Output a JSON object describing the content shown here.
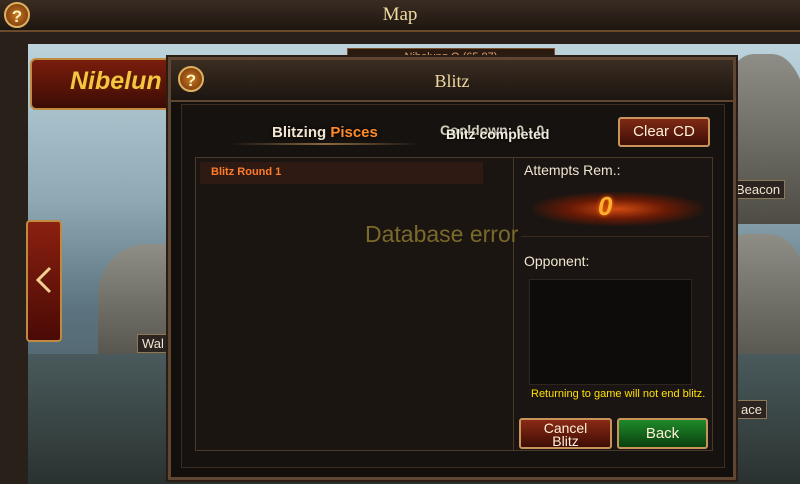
{
  "map": {
    "title": "Map",
    "help_label": "?",
    "region_name": "Nibelun",
    "location_header": "Nibelung O (65,87)",
    "labels": {
      "left_label": "Wal",
      "right_label_top": "Beacon",
      "right_label_bottom": "ace"
    },
    "nav_left_icon": "arrow-left-icon"
  },
  "blitz": {
    "title": "Blitz",
    "help_label": "?",
    "status_prefix": "Blitzing",
    "status_target": "Pisces",
    "cooldown_text": "Cooldown: 0 : 0",
    "completed_text": "Blitz completed",
    "clear_cd_label": "Clear CD",
    "rounds": [
      {
        "label": "Blitz Round 1"
      }
    ],
    "attempts_label": "Attempts Rem.:",
    "attempts_value": "0",
    "opponent_label": "Opponent:",
    "return_note": "Returning to game will not end blitz.",
    "cancel_label_line1": "Cancel",
    "cancel_label_line2": "Blitz",
    "back_label": "Back",
    "error_text": "Database error"
  },
  "colors": {
    "accent_orange": "#ff8a2a",
    "note_yellow": "#ffe000",
    "back_green": "#1f8a2a",
    "button_red": "#7e2a14"
  }
}
